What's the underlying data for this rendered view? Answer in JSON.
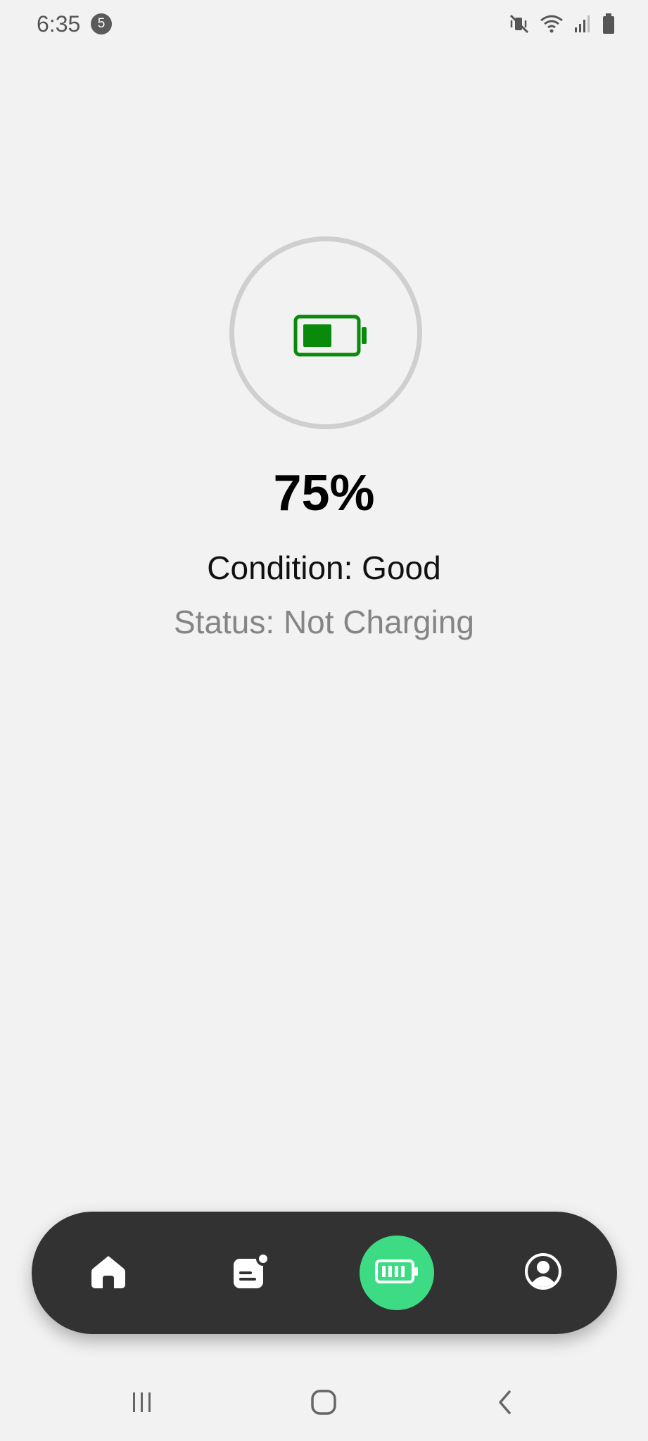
{
  "status_bar": {
    "time": "6:35",
    "notification_count": "5",
    "icons": [
      "vibrate-mute-icon",
      "wifi-icon",
      "signal-icon",
      "battery-status-icon"
    ]
  },
  "battery": {
    "level_percent": 75,
    "percent_label": "75%",
    "condition": "Condition: Good",
    "status": "Status: Not Charging",
    "icon_color": "#0a8a0a"
  },
  "bottom_nav": {
    "items": [
      {
        "name": "home",
        "icon": "home-icon",
        "active": false
      },
      {
        "name": "posts",
        "icon": "article-icon",
        "active": false
      },
      {
        "name": "battery",
        "icon": "battery-icon",
        "active": true
      },
      {
        "name": "profile",
        "icon": "account-icon",
        "active": false
      }
    ],
    "background": "#323232",
    "active_color": "#3ddc84"
  },
  "system_nav": {
    "buttons": [
      "recents-icon",
      "home-outline-icon",
      "back-icon"
    ]
  }
}
